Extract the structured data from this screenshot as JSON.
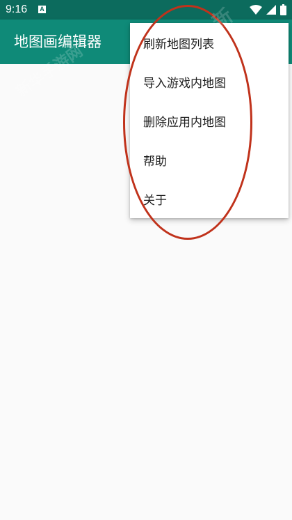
{
  "status_bar": {
    "time": "9:16",
    "notification_icon": "a-badge-icon",
    "icons": [
      "wifi-icon",
      "signal-icon",
      "battery-icon"
    ]
  },
  "app_bar": {
    "title": "地图画编辑器"
  },
  "menu": {
    "items": [
      {
        "label": "刷新地图列表"
      },
      {
        "label": "导入游戏内地图"
      },
      {
        "label": "删除应用内地图"
      },
      {
        "label": "帮助"
      },
      {
        "label": "关于"
      }
    ]
  },
  "colors": {
    "status_bar": "#0c6b5d",
    "app_bar": "#0f8a78",
    "background": "#fafafa",
    "annotation": "#c0321b"
  },
  "watermark": {
    "text_1": "新",
    "text_2": "新华手游网"
  }
}
